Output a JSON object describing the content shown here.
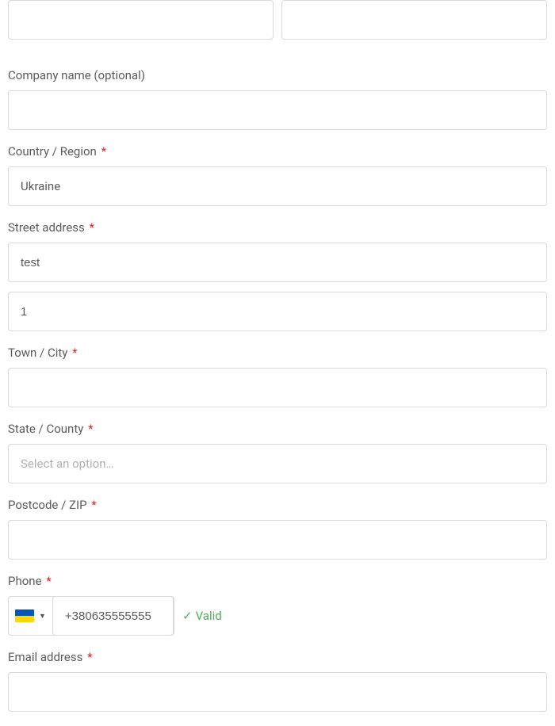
{
  "top_inputs": {
    "first_value": "",
    "second_value": ""
  },
  "company": {
    "label": "Company name (optional)",
    "value": ""
  },
  "country": {
    "label": "Country / Region",
    "required": "*",
    "value": "Ukraine"
  },
  "street": {
    "label": "Street address",
    "required": "*",
    "line1": "test",
    "line2": "1"
  },
  "city": {
    "label": "Town / City",
    "required": "*",
    "value": ""
  },
  "state": {
    "label": "State / County",
    "required": "*",
    "placeholder": "Select an option…"
  },
  "postcode": {
    "label": "Postcode / ZIP",
    "required": "*",
    "value": ""
  },
  "phone": {
    "label": "Phone",
    "required": "*",
    "value": "+380635555555",
    "valid_symbol": "✓",
    "valid_text": "Valid"
  },
  "email": {
    "label": "Email address",
    "required": "*",
    "value": ""
  }
}
